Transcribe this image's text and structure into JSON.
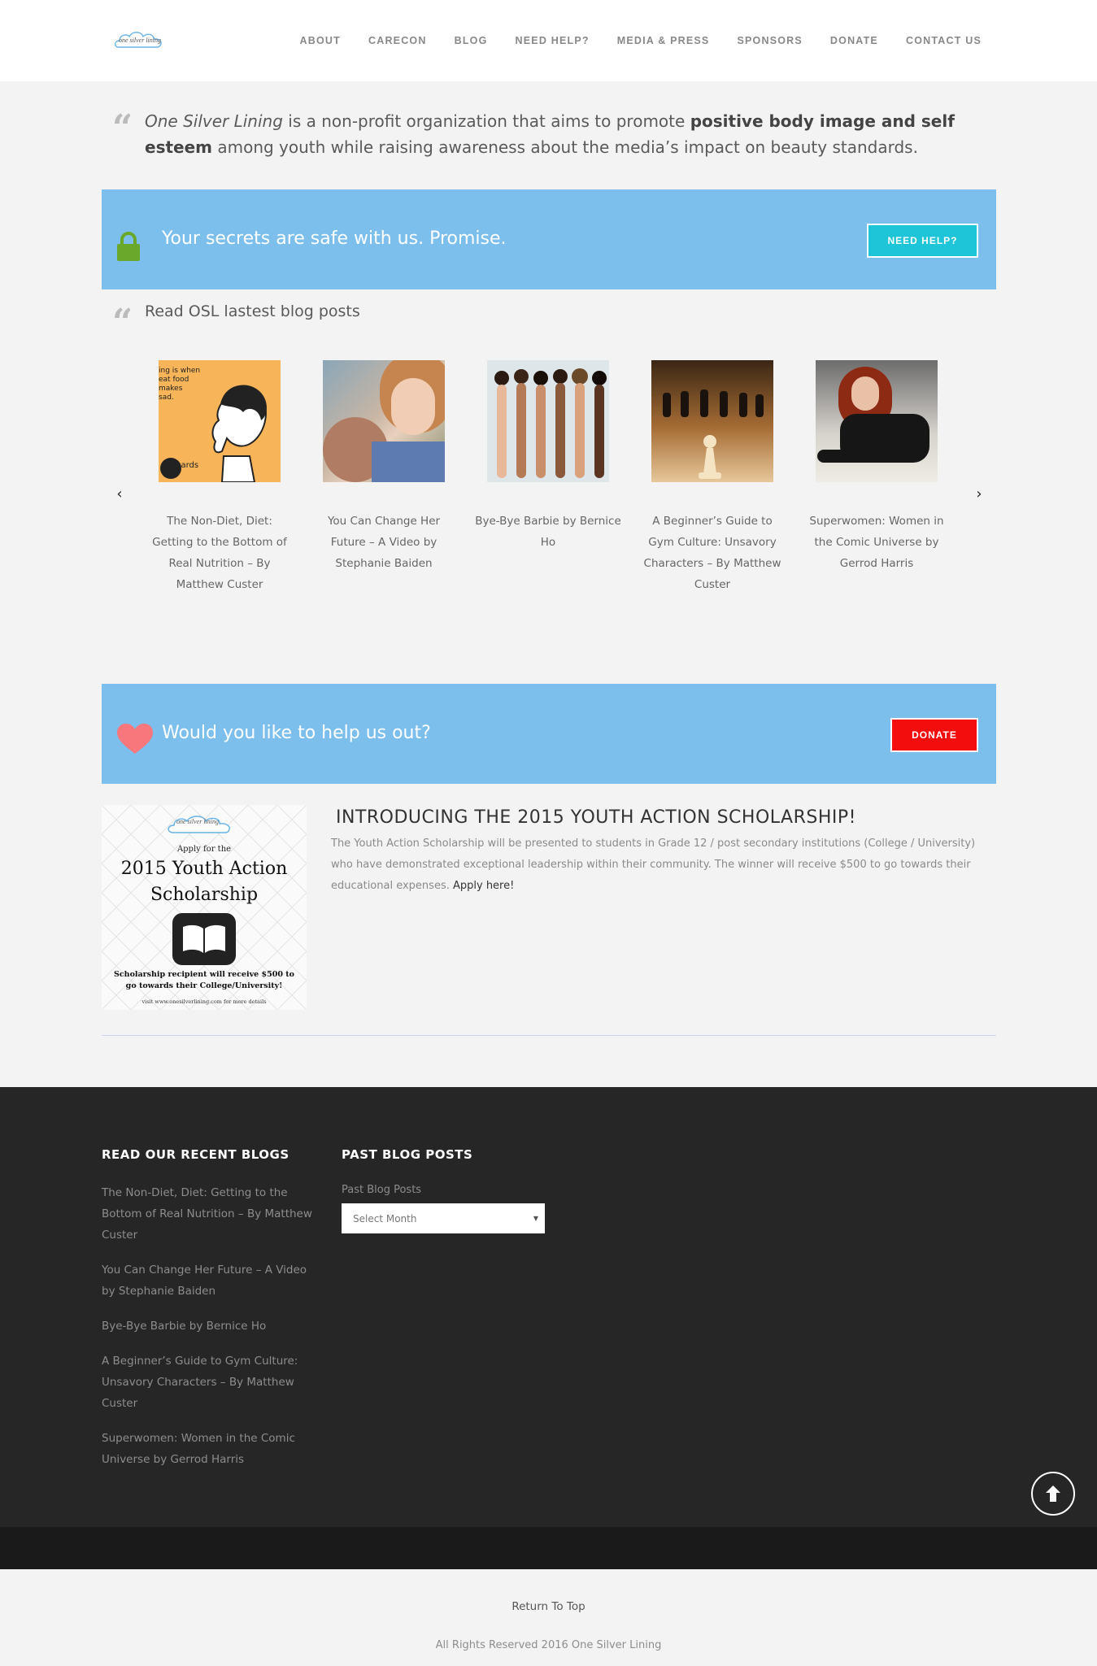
{
  "header": {
    "logo_text": "one silver lining",
    "nav": [
      "ABOUT",
      "CARECON",
      "BLOG",
      "NEED HELP?",
      "MEDIA & PRESS",
      "SPONSORS",
      "DONATE",
      "CONTACT US"
    ]
  },
  "intro": {
    "org_name": "One Silver Lining",
    "text_a": " is a non-profit organization that aims to promote ",
    "emphasis": "positive body image and self esteem",
    "text_b": " among youth while raising awareness about the media’s impact on beauty standards."
  },
  "help_banner": {
    "text": "Your secrets are safe with us. Promise.",
    "button": "NEED HELP?",
    "color": "#7cbfec",
    "button_color": "#1ec5d8"
  },
  "blog": {
    "heading": "Read OSL lastest blog posts",
    "prev_icon": "chevron-left-icon",
    "next_icon": "chevron-right-icon",
    "posts": [
      {
        "title": "The Non-Diet, Diet: Getting to the Bottom of Real Nutrition – By Matthew Custer",
        "thumb_text": "ing is when\neat food\nmakes\nsad.",
        "thumb_caption": "cards"
      },
      {
        "title": "You Can Change Her Future – A Video by Stephanie Baiden"
      },
      {
        "title": "Bye-Bye Barbie by Bernice Ho"
      },
      {
        "title": "A Beginner’s Guide to Gym Culture: Unsavory Characters – By Matthew Custer"
      },
      {
        "title": "Superwomen: Women in the Comic Universe by Gerrod Harris"
      }
    ]
  },
  "donate_banner": {
    "text": "Would you like to help us out?",
    "button": "DONATE",
    "button_color": "#f30d0d"
  },
  "scholarship": {
    "image": {
      "logo": "one silver lining",
      "apply": "Apply for the",
      "title_line1": "2015 Youth Action",
      "title_line2": "Scholarship",
      "note": "Scholarship recipient will receive $500 to go towards their College/University!",
      "visit": "visit www.onesilverlining.com for more details"
    },
    "heading": "INTRODUCING THE 2015 YOUTH ACTION SCHOLARSHIP!",
    "body": "The Youth Action Scholarship will be presented to students in Grade 12 / post secondary institutions (College / University) who have demonstrated exceptional leadership within their community. The winner will receive $500 to go towards their educational expenses. ",
    "link": "Apply here!"
  },
  "footer": {
    "recent_heading": "READ OUR RECENT BLOGS",
    "recent": [
      "The Non-Diet, Diet: Getting to the Bottom of Real Nutrition – By Matthew Custer",
      "You Can Change Her Future – A Video by Stephanie Baiden",
      "Bye-Bye Barbie by Bernice Ho",
      "A Beginner’s Guide to Gym Culture: Unsavory Characters – By Matthew Custer",
      "Superwomen: Women in the Comic Universe by Gerrod Harris"
    ],
    "past_heading": "PAST BLOG POSTS",
    "archive_label": "Past Blog Posts",
    "archive_select": "Select Month",
    "to_top_icon": "arrow-up-icon"
  },
  "bottom": {
    "return_top": "Return To Top",
    "copyright": "All Rights Reserved 2016 One Silver Lining"
  }
}
